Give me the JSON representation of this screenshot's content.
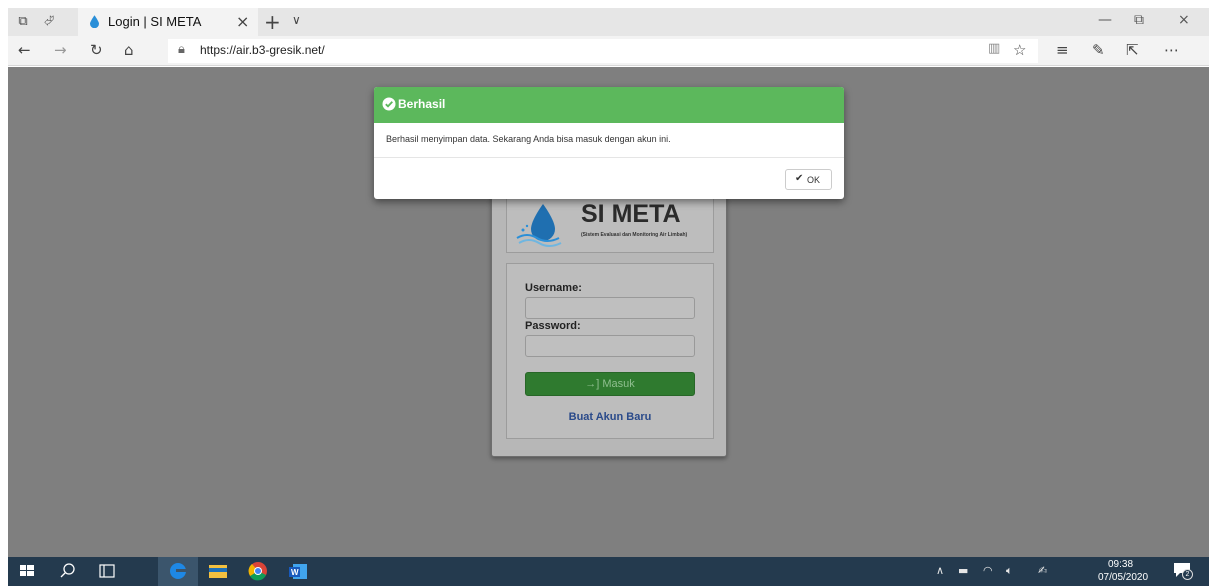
{
  "browser": {
    "tab_title": "Login | SI META",
    "url": "https://air.b3-gresik.net/"
  },
  "login": {
    "logo_title": "SI META",
    "logo_subtitle": "(Sistem Evaluasi dan Monitoring Air Limbah)",
    "username_label": "Username:",
    "password_label": "Password:",
    "submit_label": "Masuk",
    "register_link": "Buat Akun Baru"
  },
  "modal": {
    "title": "Berhasil",
    "message": "Berhasil menyimpan data. Sekarang Anda bisa masuk dengan akun ini.",
    "ok_label": "OK",
    "header_color": "#5cb85c"
  },
  "taskbar": {
    "time": "09:38",
    "date": "07/05/2020",
    "notification_count": "2"
  },
  "icons": [
    "tab-preview-icon",
    "set-aside-tabs-icon",
    "back-icon",
    "forward-icon",
    "refresh-icon",
    "home-icon",
    "lock-icon",
    "reading-view-icon",
    "favorite-star-icon",
    "favorites-icon",
    "pen-icon",
    "share-icon",
    "more-icon",
    "windows-start-icon",
    "search-icon",
    "task-view-icon",
    "edge-icon",
    "file-explorer-icon",
    "chrome-icon",
    "word-icon",
    "notification-icon"
  ]
}
